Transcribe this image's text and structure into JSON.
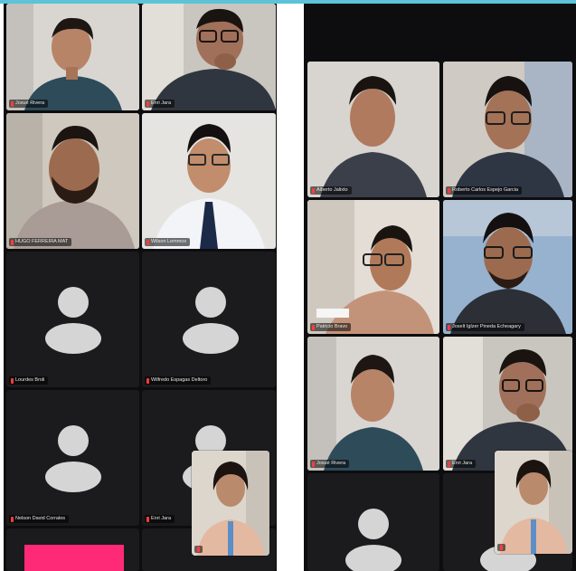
{
  "left_panel": {
    "tiles": [
      {
        "name": "Josué Rivera"
      },
      {
        "name": "Enri Jara"
      },
      {
        "name": "HUGO FERREIRA MAT"
      },
      {
        "name": "Wilson Lemmos"
      },
      {
        "name": "Lourdes Broli"
      },
      {
        "name": "Wilfredo Espagas Deltoro"
      },
      {
        "name": "Nelson David Corrales"
      },
      {
        "name": "Enri Jara"
      }
    ]
  },
  "right_panel": {
    "tiles": [
      {
        "name": "Alberto Jalixto"
      },
      {
        "name": "Roberto Carlos Espejo Garcia"
      },
      {
        "name": "Patricio Bravo"
      },
      {
        "name": "Joselt Iglzer Pineda Echeagary"
      },
      {
        "name": "Josué Rivera"
      },
      {
        "name": "Enri Jara"
      }
    ]
  },
  "colors": {
    "accent_line": "#5cc3d8",
    "active_speaker": "#2fc76a",
    "pink_block": "#ff2a77"
  }
}
